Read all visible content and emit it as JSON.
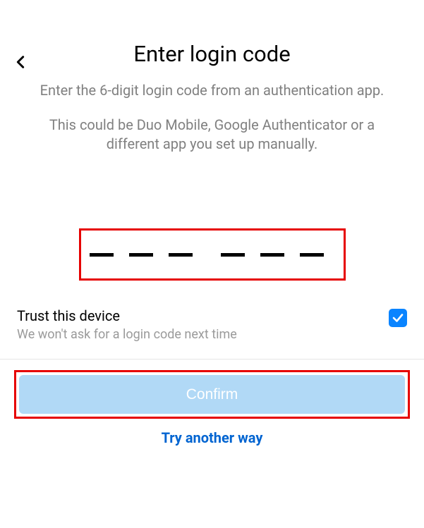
{
  "header": {
    "title": "Enter login code"
  },
  "instructions": {
    "line1": "Enter the 6-digit login code from an authentication app.",
    "line2": "This could be Duo Mobile, Google Authenticator or a different app you set up manually."
  },
  "code_input": {
    "digits": [
      "",
      "",
      "",
      "",
      "",
      ""
    ]
  },
  "trust": {
    "label": "Trust this device",
    "sublabel": "We won't ask for a login code next time",
    "checked": true
  },
  "buttons": {
    "confirm": "Confirm",
    "alt": "Try another way"
  },
  "colors": {
    "highlight": "#e60000",
    "accent": "#0a84ff",
    "link": "#0064d1",
    "confirm_bg": "#b1d9f6"
  }
}
